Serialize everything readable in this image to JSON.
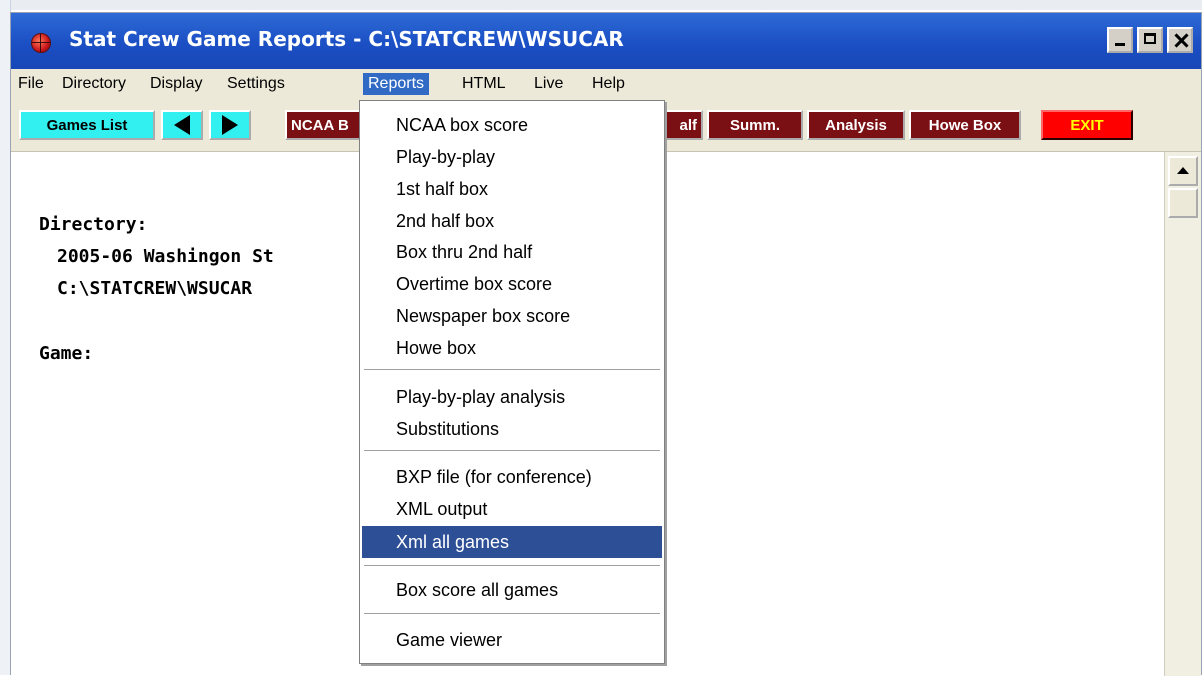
{
  "window": {
    "title": "Stat Crew Game Reports - C:\\STATCREW\\WSUCAR"
  },
  "menubar": {
    "items": [
      "File",
      "Directory",
      "Display",
      "Settings",
      "Reports",
      "HTML",
      "Live",
      "Help"
    ],
    "active": "Reports"
  },
  "toolbar": {
    "games_list": "Games List",
    "ncaa_box": "NCAA B",
    "half": "alf",
    "summ": "Summ.",
    "analysis": "Analysis",
    "howe_box": "Howe Box",
    "exit": "EXIT"
  },
  "content": {
    "directory_label": "Directory:",
    "directory_name": "2005-06 Washingon St",
    "directory_path": "C:\\STATCREW\\WSUCAR",
    "game_label": "Game:"
  },
  "reports_menu": {
    "groups": [
      [
        "NCAA box score",
        "Play-by-play",
        "1st half box",
        "2nd half box",
        "Box thru 2nd half",
        "Overtime box score",
        "Newspaper box score",
        "Howe box"
      ],
      [
        "Play-by-play analysis",
        "Substitutions"
      ],
      [
        "BXP file (for conference)",
        "XML output",
        "Xml all games"
      ],
      [
        "Box score all games"
      ],
      [
        "Game viewer"
      ]
    ],
    "highlighted": "Xml all games"
  },
  "colors": {
    "titlebar": "#1b4fc4",
    "highlight": "#2d4f96",
    "maroon_button": "#7a0f14",
    "cyan_button": "#33f0f0",
    "exit_button": "#ff0000"
  }
}
